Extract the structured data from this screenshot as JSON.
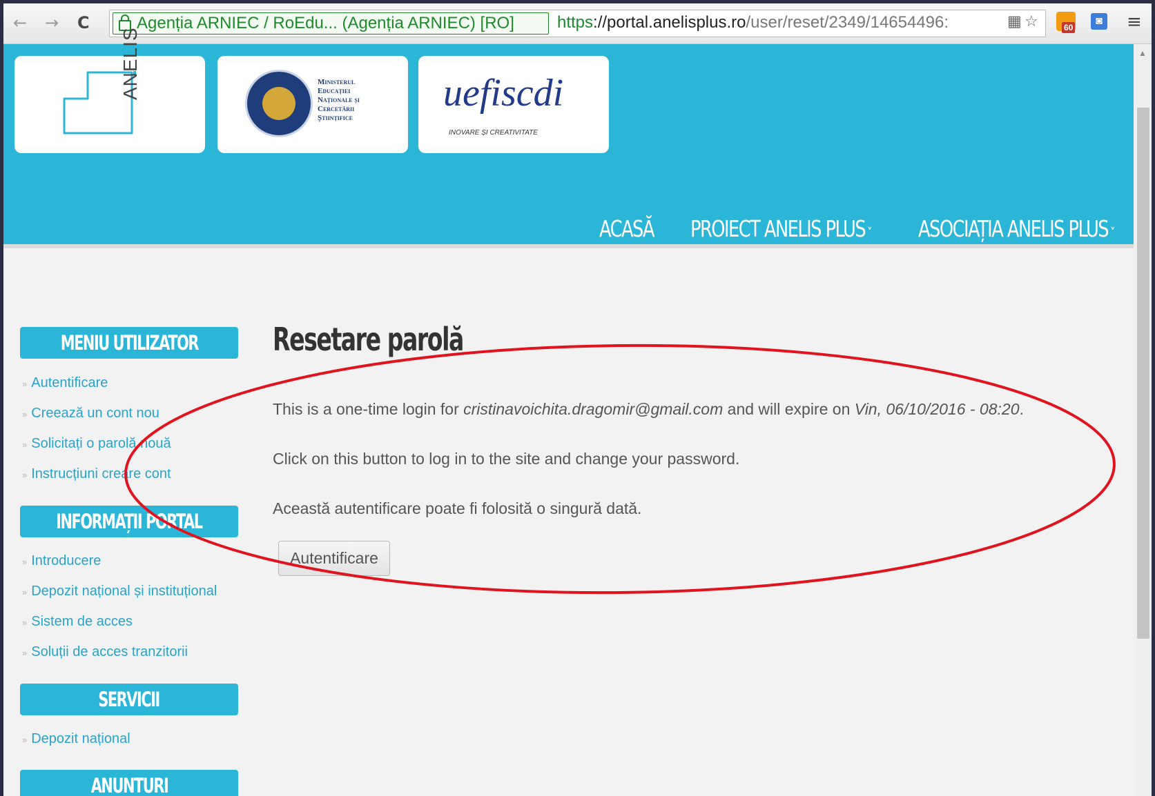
{
  "browser": {
    "ev_label": "Agenția ARNIEC / RoEdu... (Agenția ARNIEC) [RO]",
    "url_scheme": "https",
    "url_host": "://portal.anelisplus.ro",
    "url_path": "/user/reset/2349/14654496:",
    "rss_count": "60"
  },
  "header": {
    "logo_anelis": "ANELIS",
    "ministry_lines": [
      "Ministerul",
      "Educației",
      "Naționale și",
      "Cercetării",
      "Științifice"
    ],
    "uefiscdi": "uefiscdi",
    "uefiscdi_tag": "INOVARE ȘI CREATIVITATE",
    "nav": {
      "home": "ACASĂ",
      "project": "PROIECT ANELIS PLUS",
      "association": "ASOCIAȚIA ANELIS PLUS"
    }
  },
  "sidebar": {
    "user_menu": {
      "title": "MENIU UTILIZATOR",
      "items": [
        "Autentificare",
        "Creează un cont nou",
        "Solicitați o parolă nouă",
        "Instrucțiuni creare cont"
      ]
    },
    "portal_info": {
      "title": "INFORMAȚII PORTAL",
      "items": [
        "Introducere",
        "Depozit național și instituțional",
        "Sistem de acces",
        "Soluții de acces tranzitorii"
      ]
    },
    "services": {
      "title": "SERVICII",
      "items": [
        "Depozit național"
      ]
    },
    "announcements": {
      "title": "ANUNTURI"
    }
  },
  "content": {
    "title": "Resetare parolă",
    "line1_prefix": "This is a one-time login for ",
    "line1_email": "cristinavoichita.dragomir@gmail.com",
    "line1_mid": " and will expire on ",
    "line1_date": "Vin, 06/10/2016 - 08:20",
    "line1_suffix": ".",
    "line2": "Click on this button to log in to the site and change your password.",
    "line3": "Această autentificare poate fi folosită o singură dată.",
    "button": "Autentificare"
  },
  "colors": {
    "brand": "#2bb6d8",
    "link": "#2aa3c9",
    "annotation": "#e0141e"
  }
}
